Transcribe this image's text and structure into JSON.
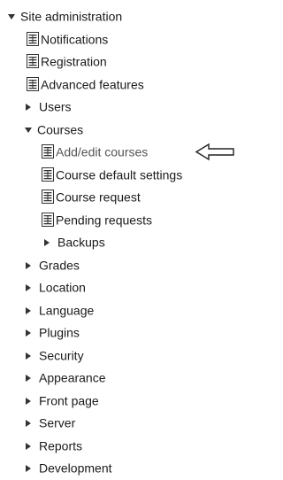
{
  "tree": {
    "root": {
      "label": "Site administration",
      "icon": "triangle-down-icon"
    },
    "items": [
      {
        "label": "Notifications",
        "icon": "document-icon"
      },
      {
        "label": "Registration",
        "icon": "document-icon"
      },
      {
        "label": "Advanced features",
        "icon": "document-icon"
      },
      {
        "label": "Users",
        "icon": "triangle-right-icon"
      },
      {
        "label": "Courses",
        "icon": "triangle-down-icon"
      },
      {
        "label": "Add/edit courses",
        "icon": "document-icon",
        "pointer": "left-arrow-icon"
      },
      {
        "label": "Course default settings",
        "icon": "document-icon"
      },
      {
        "label": "Course request",
        "icon": "document-icon"
      },
      {
        "label": "Pending requests",
        "icon": "document-icon"
      },
      {
        "label": "Backups",
        "icon": "triangle-right-icon"
      },
      {
        "label": "Grades",
        "icon": "triangle-right-icon"
      },
      {
        "label": "Location",
        "icon": "triangle-right-icon"
      },
      {
        "label": "Language",
        "icon": "triangle-right-icon"
      },
      {
        "label": "Plugins",
        "icon": "triangle-right-icon"
      },
      {
        "label": "Security",
        "icon": "triangle-right-icon"
      },
      {
        "label": "Appearance",
        "icon": "triangle-right-icon"
      },
      {
        "label": "Front page",
        "icon": "triangle-right-icon"
      },
      {
        "label": "Server",
        "icon": "triangle-right-icon"
      },
      {
        "label": "Reports",
        "icon": "triangle-right-icon"
      },
      {
        "label": "Development",
        "icon": "triangle-right-icon"
      }
    ]
  }
}
